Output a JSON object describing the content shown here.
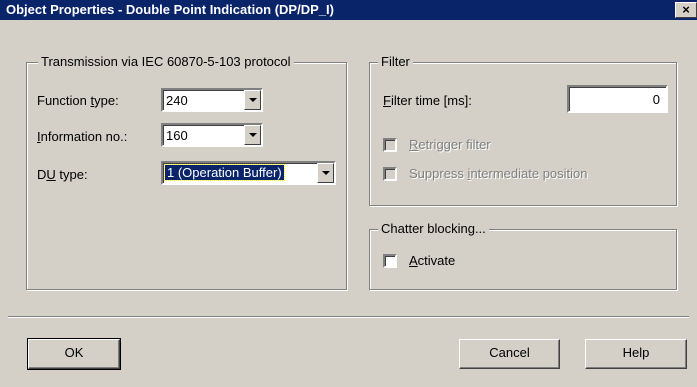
{
  "window": {
    "title": "Object Properties - Double Point Indication (DP/DP_I)",
    "close_glyph": "×"
  },
  "transmission": {
    "legend": "Transmission via IEC 60870-5-103 protocol",
    "function_type": {
      "label_pre": "Function ",
      "label_u": "t",
      "label_post": "ype:",
      "value": "240"
    },
    "information_no": {
      "label_pre": "",
      "label_u": "I",
      "label_post": "nformation no.:",
      "value": "160"
    },
    "du_type": {
      "label_pre": "D",
      "label_u": "U",
      "label_post": " type:",
      "value": "1 (Operation Buffer)"
    }
  },
  "filter": {
    "legend": "Filter",
    "filter_time": {
      "label_pre": "",
      "label_u": "F",
      "label_post": "ilter time [ms]:",
      "value": "0"
    },
    "retrigger": {
      "label_pre": "",
      "label_u": "R",
      "label_post": "etrigger filter",
      "checked": false,
      "enabled": false
    },
    "suppress": {
      "label_pre": "Suppress ",
      "label_u": "i",
      "label_post": "ntermediate position",
      "checked": false,
      "enabled": false
    }
  },
  "chatter": {
    "legend": "Chatter blocking...",
    "activate": {
      "label_pre": "",
      "label_u": "A",
      "label_post": "ctivate",
      "checked": false
    }
  },
  "buttons": {
    "ok": "OK",
    "cancel": "Cancel",
    "help": "Help"
  }
}
